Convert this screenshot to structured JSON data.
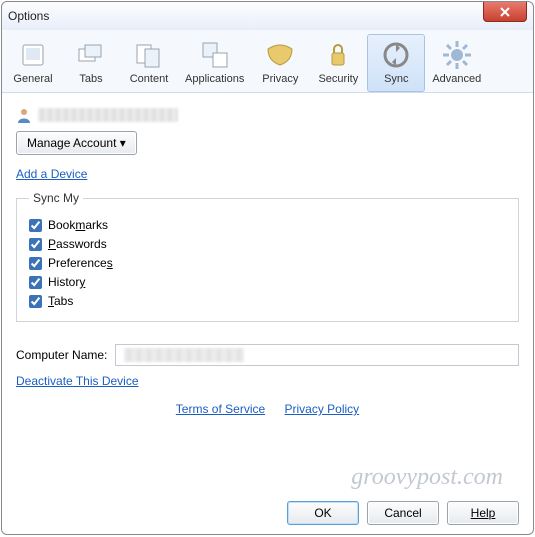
{
  "window_title": "Options",
  "tabs": [
    {
      "label": "General",
      "icon": "monitor-icon"
    },
    {
      "label": "Tabs",
      "icon": "tabs-icon"
    },
    {
      "label": "Content",
      "icon": "content-icon"
    },
    {
      "label": "Applications",
      "icon": "applications-icon"
    },
    {
      "label": "Privacy",
      "icon": "mask-icon"
    },
    {
      "label": "Security",
      "icon": "lock-icon"
    },
    {
      "label": "Sync",
      "icon": "sync-icon",
      "active": true
    },
    {
      "label": "Advanced",
      "icon": "gear-icon"
    }
  ],
  "manage_account_label": "Manage Account",
  "add_device_label": "Add a Device",
  "sync_my_legend": "Sync My",
  "sync_items": [
    {
      "label_pre": "Book",
      "mnemonic": "m",
      "label_post": "arks",
      "checked": true
    },
    {
      "label_pre": "",
      "mnemonic": "P",
      "label_post": "asswords",
      "checked": true
    },
    {
      "label_pre": "Preference",
      "mnemonic": "s",
      "label_post": "",
      "checked": true
    },
    {
      "label_pre": "Histor",
      "mnemonic": "y",
      "label_post": "",
      "checked": true
    },
    {
      "label_pre": "",
      "mnemonic": "T",
      "label_post": "abs",
      "checked": true
    }
  ],
  "computer_name_label": "Computer Name:",
  "computer_name_value": "",
  "deactivate_label": "Deactivate This Device",
  "tos_label": "Terms of Service",
  "privacy_label": "Privacy Policy",
  "ok_label": "OK",
  "cancel_label": "Cancel",
  "help_label": "Help",
  "watermark": "groovypost.com"
}
